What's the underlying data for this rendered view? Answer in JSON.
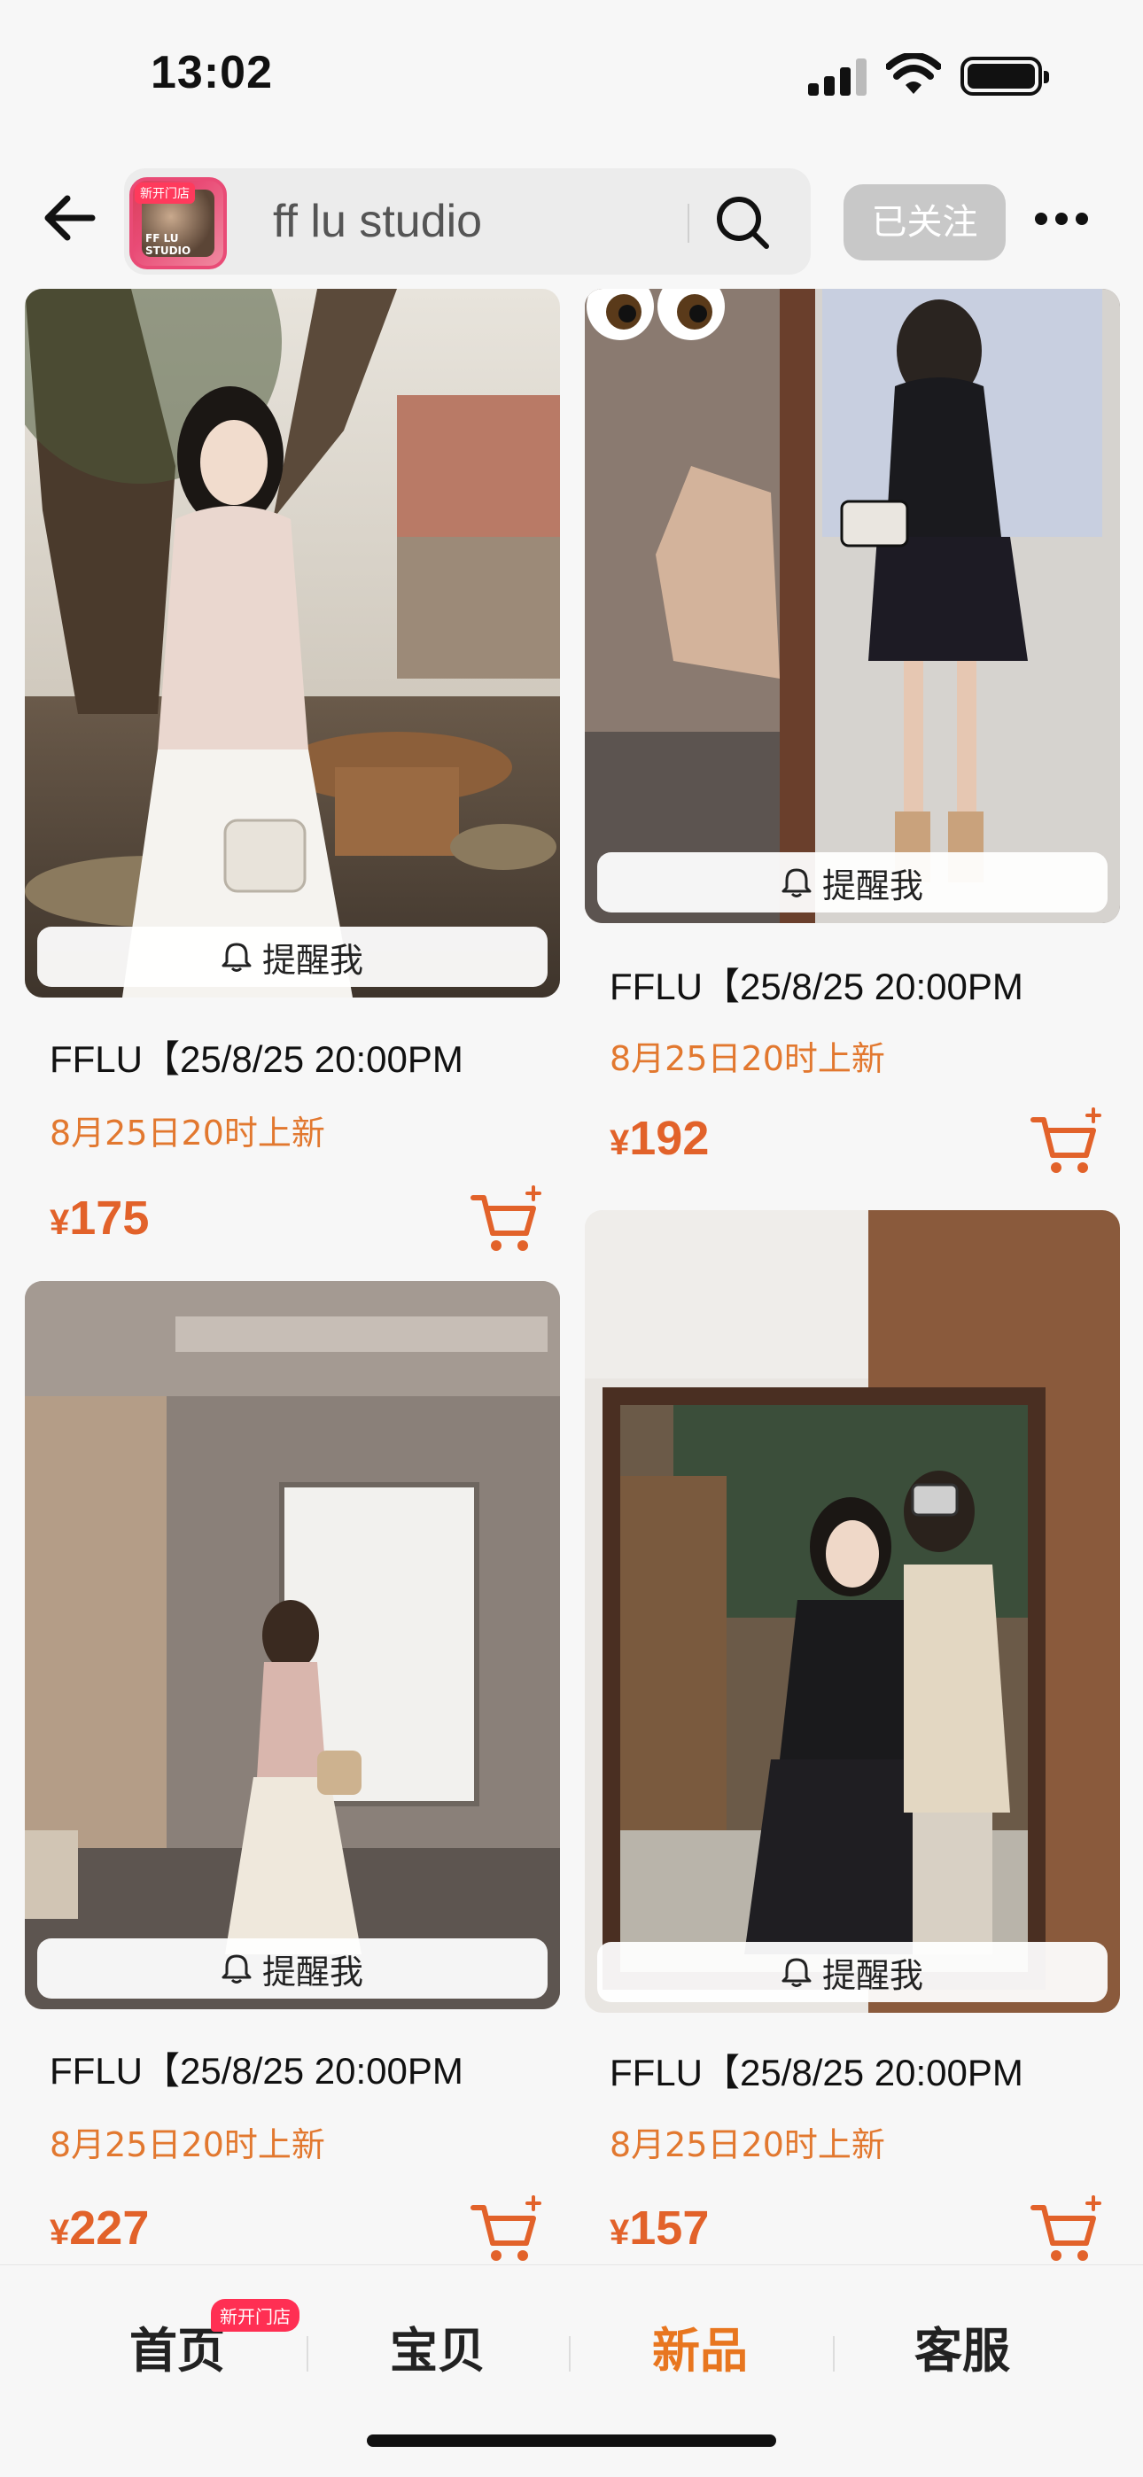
{
  "status_bar": {
    "time": "13:02"
  },
  "header": {
    "store_badge": "新开门店",
    "store_logo_text": "FF LU STUDIO",
    "search_text": "ff lu studio",
    "follow_label": "已关注"
  },
  "products": [
    {
      "remind_label": "提醒我",
      "title": "FFLU【25/8/25 20:00PM",
      "subtitle": "8月25日20时上新",
      "currency": "¥",
      "price": "175"
    },
    {
      "remind_label": "提醒我",
      "title": "FFLU【25/8/25 20:00PM",
      "subtitle": "8月25日20时上新",
      "currency": "¥",
      "price": "192"
    },
    {
      "remind_label": "提醒我",
      "title": "FFLU【25/8/25 20:00PM",
      "subtitle": "8月25日20时上新",
      "currency": "¥",
      "price": "227"
    },
    {
      "remind_label": "提醒我",
      "title": "FFLU【25/8/25 20:00PM",
      "subtitle": "8月25日20时上新",
      "currency": "¥",
      "price": "157"
    }
  ],
  "bottom_nav": {
    "items": [
      {
        "label": "首页"
      },
      {
        "label": "宝贝"
      },
      {
        "label": "新品"
      },
      {
        "label": "客服"
      }
    ],
    "badge": "新开门店",
    "active": "新品"
  },
  "colors": {
    "accent": "#e8761f",
    "price": "#e2622a",
    "subtitle": "#e2782f"
  }
}
